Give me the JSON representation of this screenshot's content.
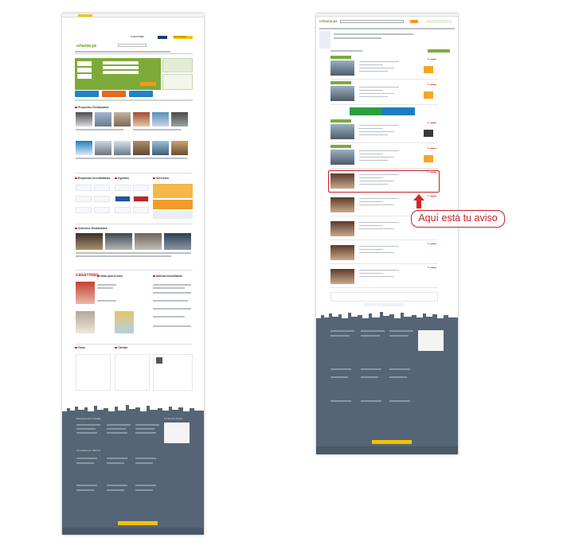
{
  "annotation": {
    "callout": "Aquí está tu aviso",
    "accent": "#c8202b"
  },
  "left_page": {
    "logo": "urbania.pe",
    "header_badges": {
      "publish": "Encuéntralo",
      "newspaper": "El Comercio"
    },
    "sections": {
      "featured_projects": "Proyectos Destacados",
      "real_estate": "Empresas inmobiliarias",
      "agents": "Agentes",
      "services": "Servicios",
      "featured_articles": "Artículos Destacados",
      "casa_mas": "casa+más",
      "ideas": "Ideas para tu casa",
      "news": "Noticias Inmobiliarias",
      "forums": "Foros",
      "blog": "Tiendas",
      "footer_zone": "Búsqueda de inmueble",
      "footer_help": "Central de Ayuda",
      "footer_districts": "Inmuebles por distritos"
    }
  },
  "right_page": {
    "logo": "urbania.pe",
    "listing_count": 9,
    "highlighted_index": 4
  },
  "colors": {
    "brand_green": "#7dab3a",
    "footer": "#566576",
    "price_red": "#d3262b",
    "action_orange": "#f39a1c",
    "link_blue": "#1f83c4"
  }
}
